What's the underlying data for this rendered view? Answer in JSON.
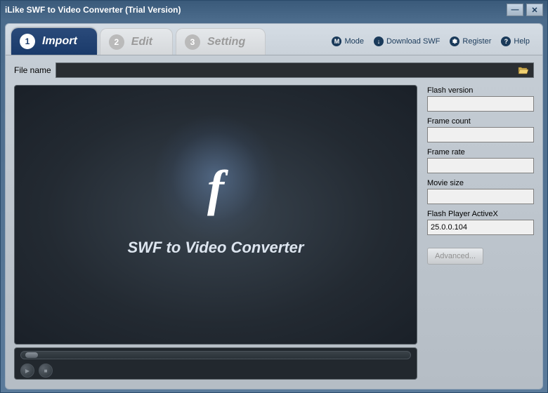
{
  "window": {
    "title": "iLike SWF to Video Converter (Trial Version)"
  },
  "tabs": [
    {
      "num": "1",
      "label": "Import"
    },
    {
      "num": "2",
      "label": "Edit"
    },
    {
      "num": "3",
      "label": "Setting"
    }
  ],
  "toolbar": {
    "mode": "Mode",
    "download": "Download SWF",
    "register": "Register",
    "help": "Help",
    "mode_icon": "M",
    "download_icon": "↓",
    "register_icon": "✽",
    "help_icon": "?"
  },
  "filename": {
    "label": "File name",
    "value": ""
  },
  "preview": {
    "flash_glyph": "f",
    "text": "SWF to Video Converter"
  },
  "info": {
    "flash_version": {
      "label": "Flash version",
      "value": ""
    },
    "frame_count": {
      "label": "Frame count",
      "value": ""
    },
    "frame_rate": {
      "label": "Frame rate",
      "value": ""
    },
    "movie_size": {
      "label": "Movie size",
      "value": ""
    },
    "flash_activex": {
      "label": "Flash Player ActiveX",
      "value": "25.0.0.104"
    },
    "advanced": "Advanced..."
  }
}
